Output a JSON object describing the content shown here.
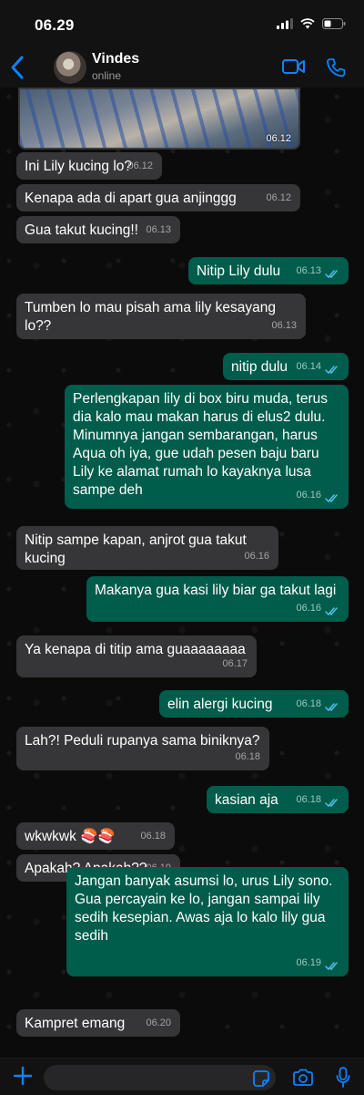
{
  "status": {
    "time": "06.29"
  },
  "header": {
    "name": "Vindes",
    "status": "online"
  },
  "media": {
    "time": "06.12"
  },
  "messages": [
    {
      "dir": "in",
      "text": "Ini Lily kucing lo?",
      "time": "06.12"
    },
    {
      "dir": "in",
      "text": "Kenapa ada di apart gua anjinggg",
      "time": "06.12"
    },
    {
      "dir": "in",
      "text": "Gua takut kucing!!",
      "time": "06.13"
    },
    {
      "dir": "out",
      "text": "Nitip Lily dulu",
      "time": "06.13"
    },
    {
      "dir": "in",
      "text": "Tumben lo mau pisah ama lily kesayang lo??",
      "time": "06.13"
    },
    {
      "dir": "out",
      "text": "nitip dulu",
      "time": "06.14"
    },
    {
      "dir": "out",
      "text": "Perlengkapan lily di box biru muda, terus dia kalo mau makan harus di elus2 dulu. Minumnya jangan sembarangan, harus Aqua oh iya, gue udah pesen baju baru Lily ke alamat rumah lo kayaknya lusa sampe deh",
      "time": "06.16"
    },
    {
      "dir": "in",
      "text": "Nitip sampe kapan, anjrot gua takut kucing",
      "time": "06.16"
    },
    {
      "dir": "out",
      "text": "Makanya gua kasi lily biar ga takut lagi",
      "time": "06.16"
    },
    {
      "dir": "in",
      "text": "Ya kenapa di titip ama guaaaaaaaa",
      "time": "06.17"
    },
    {
      "dir": "out",
      "text": "elin alergi kucing",
      "time": "06.18"
    },
    {
      "dir": "in",
      "text": "Lah?! Peduli rupanya sama biniknya?",
      "time": "06.18"
    },
    {
      "dir": "out",
      "text": "kasian aja",
      "time": "06.18"
    },
    {
      "dir": "in",
      "text": "wkwkwk 🍣🍣",
      "time": "06.18"
    },
    {
      "dir": "in",
      "text": "Apakah? Apakah??",
      "time": "06.19"
    },
    {
      "dir": "out",
      "text": "Jangan banyak asumsi lo, urus Lily sono. Gua percayain ke lo, jangan sampai lily sedih kesepian. Awas aja lo kalo lily gua sedih",
      "time": "06.19"
    },
    {
      "dir": "in",
      "text": "Kampret emang",
      "time": "06.20"
    }
  ],
  "input": {
    "value": "",
    "placeholder": ""
  },
  "colors": {
    "accent": "#0a84ff",
    "incoming": "#363638",
    "outgoing": "#005c4b",
    "read_ticks": "#53bdeb"
  }
}
